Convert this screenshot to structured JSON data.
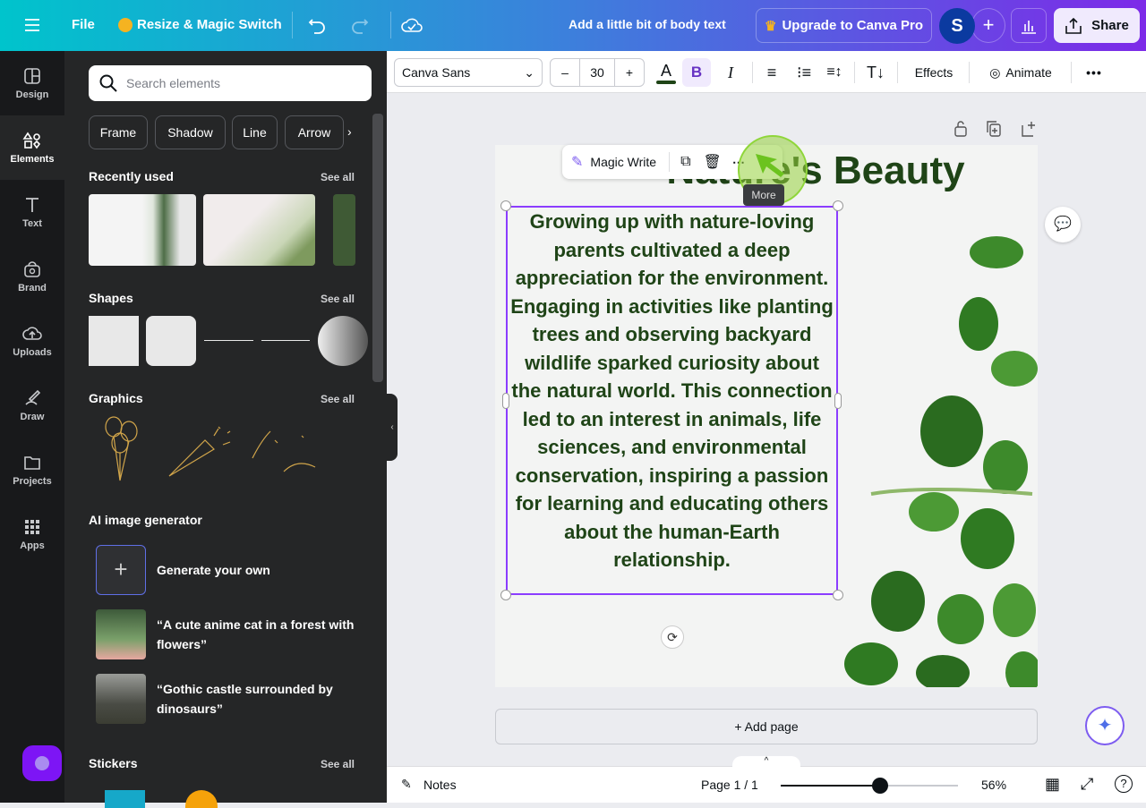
{
  "topbar": {
    "menu_icon": "hamburger-icon",
    "file": "File",
    "resize": "Resize & Magic Switch",
    "doc_title": "Add a little bit of body text",
    "upgrade": "Upgrade to Canva Pro",
    "avatar": "S",
    "share": "Share"
  },
  "rail": [
    {
      "label": "Design",
      "icon": "design-icon"
    },
    {
      "label": "Elements",
      "icon": "elements-icon",
      "active": true
    },
    {
      "label": "Text",
      "icon": "text-icon"
    },
    {
      "label": "Brand",
      "icon": "brand-icon"
    },
    {
      "label": "Uploads",
      "icon": "uploads-icon"
    },
    {
      "label": "Draw",
      "icon": "draw-icon"
    },
    {
      "label": "Projects",
      "icon": "folder-icon"
    },
    {
      "label": "Apps",
      "icon": "apps-icon"
    }
  ],
  "panel": {
    "search_placeholder": "Search elements",
    "chips": [
      "Frame",
      "Shadow",
      "Line",
      "Arrow"
    ],
    "recent": "Recently used",
    "shapes": "Shapes",
    "graphics": "Graphics",
    "ai": "AI image generator",
    "stickers": "Stickers",
    "see_all": "See all",
    "ai_items": [
      "Generate your own",
      "“A cute anime cat in a forest with flowers”",
      "“Gothic castle surrounded by dinosaurs”"
    ]
  },
  "toolbar": {
    "font": "Canva Sans",
    "size": "30",
    "effects": "Effects",
    "animate": "Animate",
    "text_color": "#1f4417"
  },
  "canvas": {
    "title": "Nature's Beauty",
    "body": "Growing up with nature-loving parents cultivated a deep appreciation for the environment. Engaging in activities like planting trees and observing backyard wildlife sparked curiosity about the natural world. This connection led to an interest in animals, life sciences, and environmental conservation, inspiring a passion for learning and educating others about the human-Earth relationship.",
    "magic_write": "Magic Write",
    "tooltip": "More",
    "add_page": "+ Add page"
  },
  "bottom": {
    "notes": "Notes",
    "page": "Page 1 / 1",
    "zoom": "56%",
    "zoom_value": 56
  }
}
